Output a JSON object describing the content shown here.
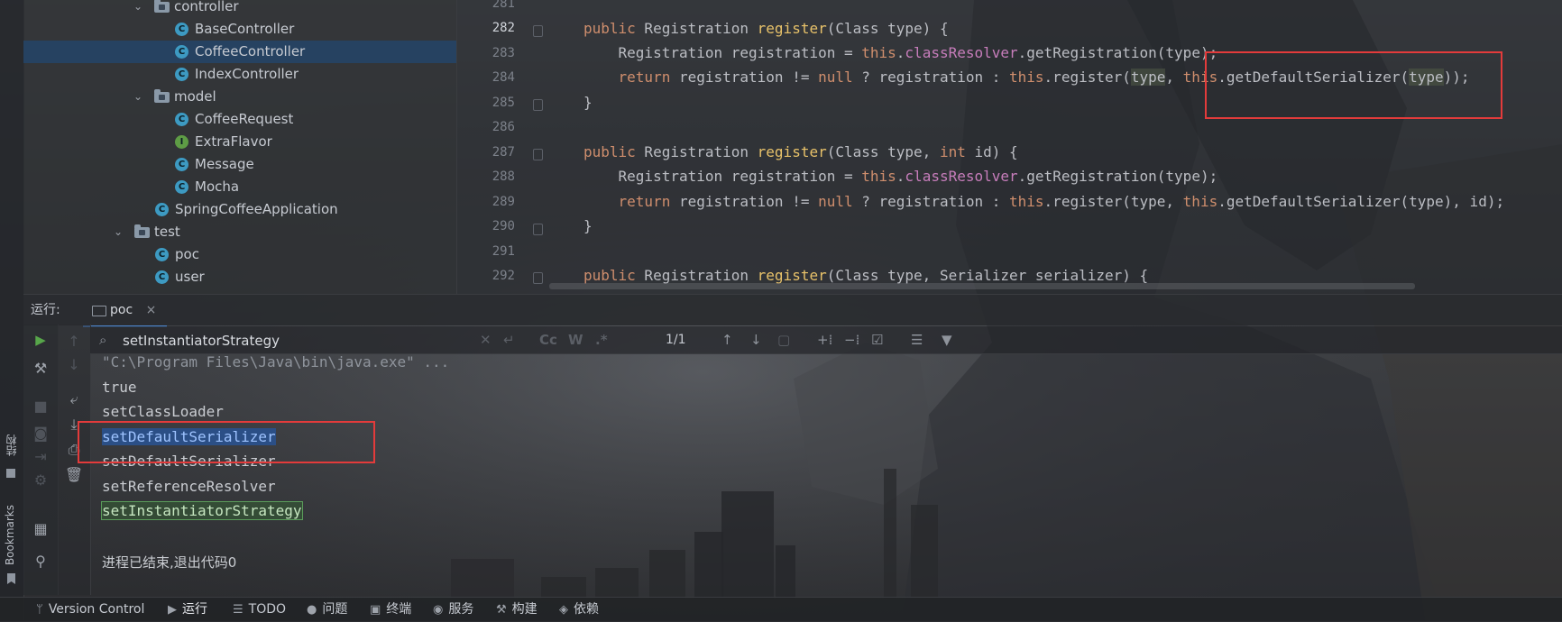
{
  "project_tree": {
    "items": [
      {
        "label": "controller",
        "kind": "folder",
        "expanded": true
      },
      {
        "label": "BaseController",
        "kind": "class"
      },
      {
        "label": "CoffeeController",
        "kind": "class",
        "selected": true
      },
      {
        "label": "IndexController",
        "kind": "class"
      },
      {
        "label": "model",
        "kind": "folder",
        "expanded": true
      },
      {
        "label": "CoffeeRequest",
        "kind": "class"
      },
      {
        "label": "ExtraFlavor",
        "kind": "interface"
      },
      {
        "label": "Message",
        "kind": "class"
      },
      {
        "label": "Mocha",
        "kind": "class"
      },
      {
        "label": "SpringCoffeeApplication",
        "kind": "main-class"
      },
      {
        "label": "test",
        "kind": "folder",
        "expanded": true
      },
      {
        "label": "poc",
        "kind": "class"
      },
      {
        "label": "user",
        "kind": "class"
      }
    ]
  },
  "editor": {
    "current_line": "282",
    "line_numbers": [
      "281",
      "282",
      "283",
      "284",
      "285",
      "286",
      "287",
      "288",
      "289",
      "290",
      "291",
      "292"
    ],
    "code_lines": [
      "",
      "public Registration register(Class type) {",
      "    Registration registration = this.classResolver.getRegistration(type);",
      "    return registration != null ? registration : this.register(type, this.getDefaultSerializer(type));",
      "}",
      "",
      "public Registration register(Class type, int id) {",
      "    Registration registration = this.classResolver.getRegistration(type);",
      "    return registration != null ? registration : this.register(type, this.getDefaultSerializer(type), id);",
      "}",
      "",
      "public Registration register(Class type, Serializer serializer) {"
    ]
  },
  "run_panel": {
    "title": "运行:",
    "tab_label": "poc",
    "tab_close": "×",
    "search": {
      "value": "setInstantiatorStrategy",
      "match_count": "1/1",
      "opt_case": "Cc",
      "opt_word": "W",
      "opt_regex": ".*"
    },
    "console_lines": [
      "\"C:\\Program Files\\Java\\bin\\java.exe\" ...",
      "true",
      "setClassLoader",
      "setDefaultSerializer",
      "setDefaultSerializer",
      "setReferenceResolver",
      "setInstantiatorStrategy",
      "",
      "进程已结束,退出代码0"
    ]
  },
  "side_labels": {
    "structure": "结构",
    "bookmarks": "Bookmarks"
  },
  "status_bar": {
    "items": [
      "Version Control",
      "运行",
      "TODO",
      "问题",
      "终端",
      "服务",
      "构建",
      "依赖"
    ],
    "active": "运行"
  },
  "colors": {
    "accent_blue": "#4e84c7",
    "annotation_red": "#e33b3b",
    "keyword": "#cf8e6d",
    "method": "#e8c26a",
    "field": "#c77dbb"
  }
}
